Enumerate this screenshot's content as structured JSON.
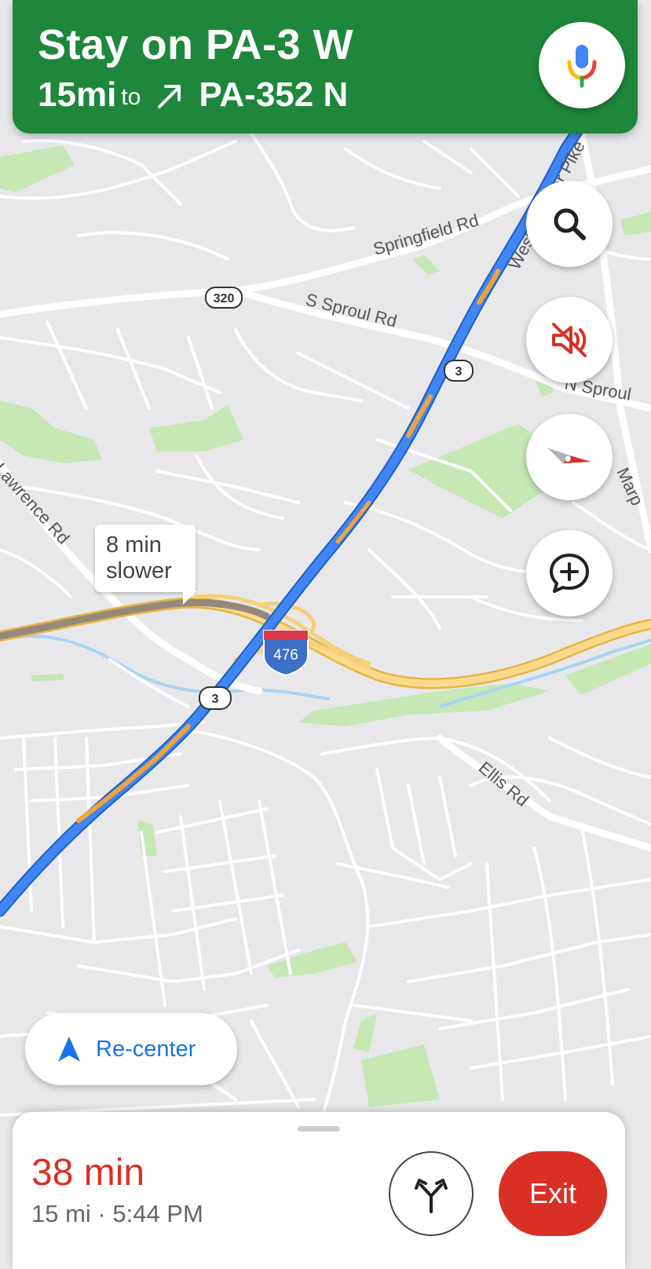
{
  "banner": {
    "instruction": "Stay on PA-3 W",
    "distance": "15mi",
    "to_word": "to",
    "next_road": "PA-352 N",
    "turn_icon": "turn-slight-right-icon"
  },
  "map": {
    "road_labels": {
      "springfield": "Springfield Rd",
      "s_sproul": "S Sproul Rd",
      "n_sproul": "N Sproul",
      "lawrence": "Lawrence Rd",
      "ellis": "Ellis Rd",
      "west_chester": "West Chester Pike",
      "marple": "Marp"
    },
    "shields": {
      "route_320": "320",
      "route_3_upper": "3",
      "route_3_lower": "3",
      "interstate_476": "476"
    },
    "traffic_callout": {
      "line1": "8 min",
      "line2": "slower"
    }
  },
  "controls": {
    "voice_icon": "microphone-icon",
    "search_icon": "search-icon",
    "mute_icon": "sound-off-icon",
    "compass_icon": "compass-icon",
    "report_icon": "add-report-icon"
  },
  "recenter": {
    "label": "Re-center",
    "icon": "navigation-arrow-icon"
  },
  "eta": {
    "duration": "38 min",
    "details": "15 mi · 5:44 PM"
  },
  "actions": {
    "routes_icon": "alternate-routes-icon",
    "exit_label": "Exit"
  },
  "colors": {
    "banner_green": "#1e873b",
    "route_blue": "#4285f4",
    "traffic_orange": "#f2a33a",
    "eta_red": "#d93025",
    "exit_red": "#d93025",
    "accent_blue": "#1a73e8"
  }
}
